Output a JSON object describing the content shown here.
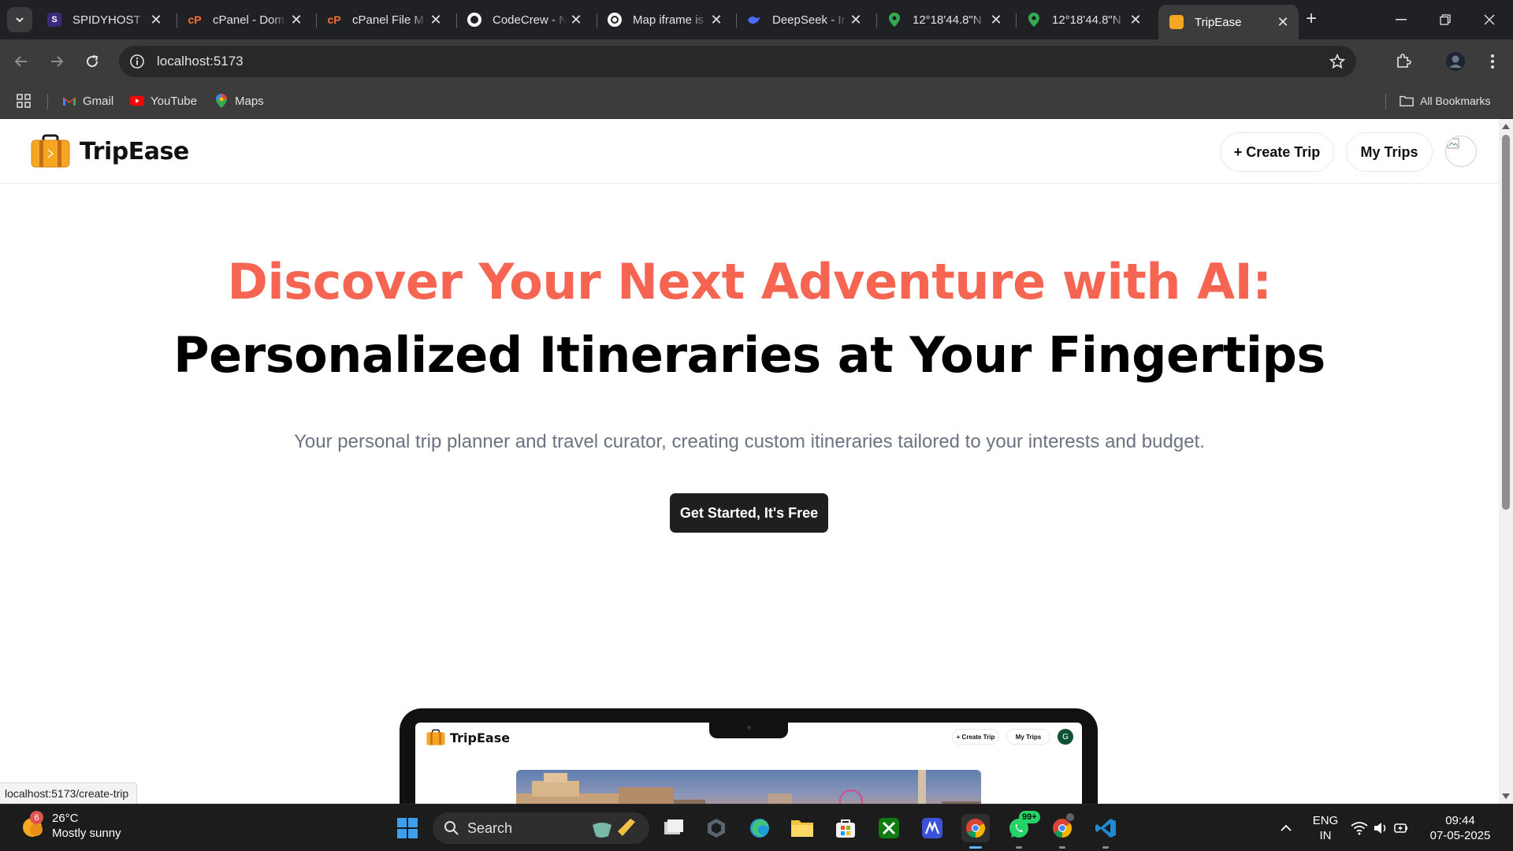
{
  "browser": {
    "tabs": [
      {
        "label": "SPIDYHOST -",
        "icon": "spidyhost-favicon"
      },
      {
        "label": "cPanel - Dom",
        "icon": "cpanel-favicon"
      },
      {
        "label": "cPanel File M",
        "icon": "cpanel-favicon"
      },
      {
        "label": "CodeCrew - N",
        "icon": "github-favicon"
      },
      {
        "label": "Map iframe is",
        "icon": "openai-favicon"
      },
      {
        "label": "DeepSeek - Ir",
        "icon": "deepseek-favicon"
      },
      {
        "label": "12°18'44.8\"N",
        "icon": "google-maps-favicon"
      },
      {
        "label": "12°18'44.8\"N",
        "icon": "google-maps-favicon"
      },
      {
        "label": "TripEase",
        "icon": "tripease-favicon",
        "active": true
      }
    ],
    "url": "localhost:5173",
    "bookmarks": [
      {
        "label": "Gmail",
        "icon": "gmail-icon"
      },
      {
        "label": "YouTube",
        "icon": "youtube-icon"
      },
      {
        "label": "Maps",
        "icon": "maps-icon"
      }
    ],
    "all_bookmarks_label": "All Bookmarks",
    "status_url": "localhost:5173/create-trip"
  },
  "site": {
    "brand": "TripEase",
    "nav": {
      "create_trip": "+ Create Trip",
      "my_trips": "My Trips"
    },
    "hero": {
      "line1": "Discover Your Next Adventure with AI:",
      "line2": "Personalized Itineraries at Your Fingertips",
      "subtitle": "Your personal trip planner and travel curator, creating custom itineraries tailored to your interests and budget.",
      "cta": "Get Started, It's Free"
    },
    "preview": {
      "brand": "TripEase",
      "create_trip": "+ Create Trip",
      "my_trips": "My Trips",
      "avatar_initial": "G"
    },
    "colors": {
      "accent": "#f56551",
      "cta_bg": "#1f1f1f"
    }
  },
  "taskbar": {
    "weather": {
      "temp": "26°C",
      "desc": "Mostly sunny",
      "badge": "6"
    },
    "search_label": "Search",
    "whatsapp_badge": "99+",
    "language": {
      "line1": "ENG",
      "line2": "IN"
    },
    "clock": {
      "time": "09:44",
      "date": "07-05-2025"
    }
  }
}
